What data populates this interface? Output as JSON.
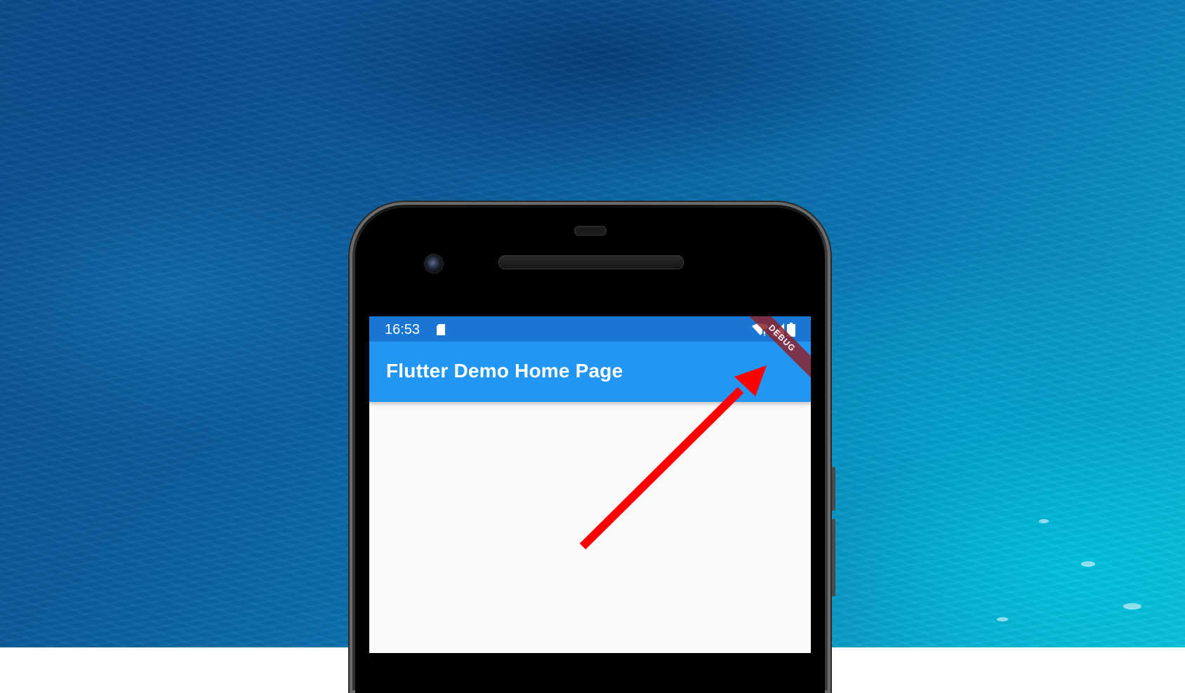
{
  "device": {
    "status_bar": {
      "time": "16:53",
      "icons": [
        "sd-card-icon",
        "wifi-icon",
        "signal-icon",
        "battery-icon"
      ]
    },
    "app_bar": {
      "title": "Flutter Demo Home Page"
    },
    "debug_banner": {
      "label": "DEBUG"
    }
  },
  "colors": {
    "status_bar": "#1976d2",
    "app_bar": "#2196f3",
    "body": "#fafafa",
    "arrow": "#ff0000",
    "debug_banner": "#8c232d"
  }
}
